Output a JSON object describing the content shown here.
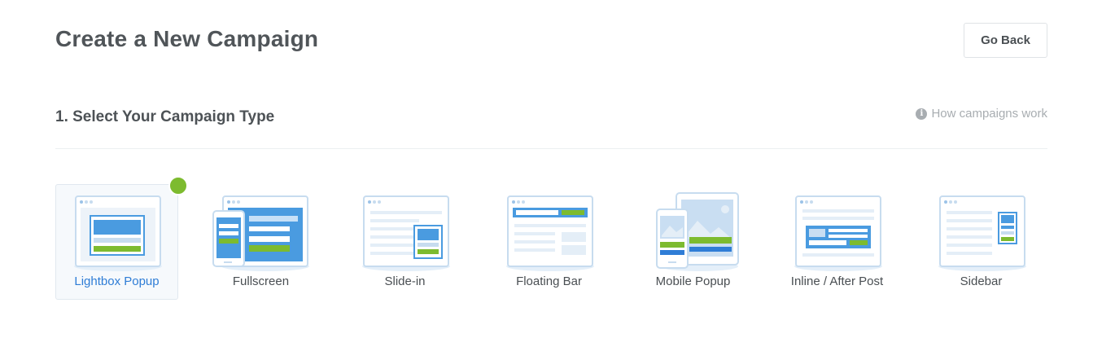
{
  "header": {
    "title": "Create a New Campaign",
    "go_back_label": "Go Back"
  },
  "section": {
    "title": "1. Select Your Campaign Type",
    "help_link": "How campaigns work",
    "help_icon": "info-icon"
  },
  "campaign_types": [
    {
      "label": "Lightbox Popup",
      "selected": true
    },
    {
      "label": "Fullscreen",
      "selected": false
    },
    {
      "label": "Slide-in",
      "selected": false
    },
    {
      "label": "Floating Bar",
      "selected": false
    },
    {
      "label": "Mobile Popup",
      "selected": false
    },
    {
      "label": "Inline / After Post",
      "selected": false
    },
    {
      "label": "Sidebar",
      "selected": false
    }
  ],
  "colors": {
    "accent_blue": "#2f7dd6",
    "illustration_blue": "#4a9be0",
    "check_green": "#7dbb2f"
  }
}
